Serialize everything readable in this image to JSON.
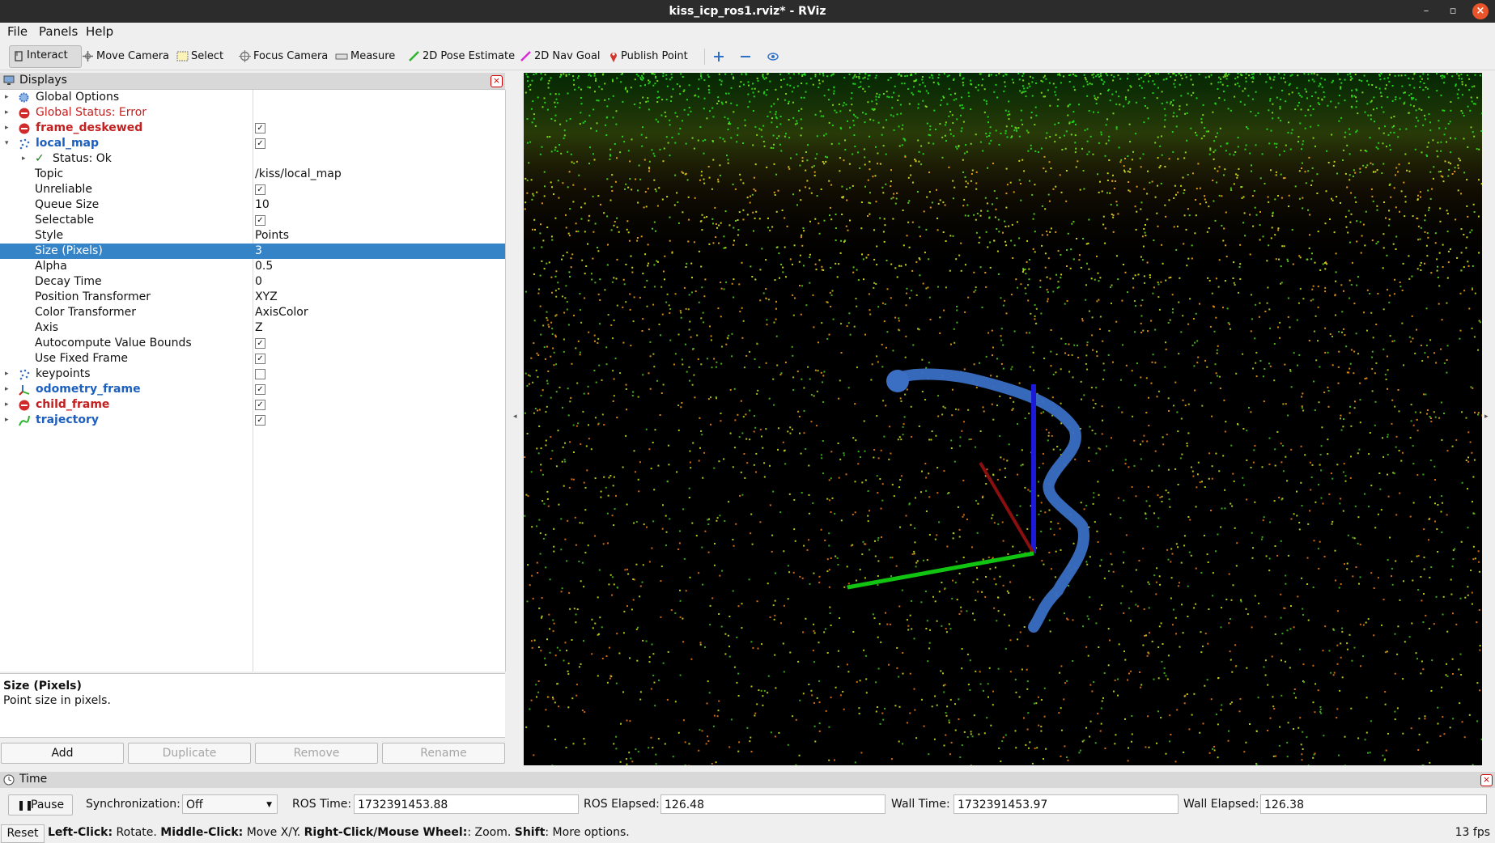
{
  "window": {
    "title": "kiss_icp_ros1.rviz* - RViz"
  },
  "menu": [
    "File",
    "Panels",
    "Help"
  ],
  "toolbar": {
    "interact": "Interact",
    "move_camera": "Move Camera",
    "select": "Select",
    "focus_camera": "Focus Camera",
    "measure": "Measure",
    "pose_estimate": "2D Pose Estimate",
    "nav_goal": "2D Nav Goal",
    "publish_point": "Publish Point"
  },
  "displays": {
    "header": "Displays",
    "rows": {
      "global_options": "Global Options",
      "global_status": "Global Status: Error",
      "frame_deskewed": "frame_deskewed",
      "local_map": "local_map",
      "status_ok": "Status: Ok",
      "topic": {
        "label": "Topic",
        "value": "/kiss/local_map"
      },
      "unreliable": "Unreliable",
      "queue_size": {
        "label": "Queue Size",
        "value": "10"
      },
      "selectable": "Selectable",
      "style": {
        "label": "Style",
        "value": "Points"
      },
      "size_pixels": {
        "label": "Size (Pixels)",
        "value": "3"
      },
      "alpha": {
        "label": "Alpha",
        "value": "0.5"
      },
      "decay_time": {
        "label": "Decay Time",
        "value": "0"
      },
      "position_transformer": {
        "label": "Position Transformer",
        "value": "XYZ"
      },
      "color_transformer": {
        "label": "Color Transformer",
        "value": "AxisColor"
      },
      "axis": {
        "label": "Axis",
        "value": "Z"
      },
      "autocompute": "Autocompute Value Bounds",
      "use_fixed_frame": "Use Fixed Frame",
      "keypoints": "keypoints",
      "odometry_frame": "odometry_frame",
      "child_frame": "child_frame",
      "trajectory": "trajectory"
    },
    "description": {
      "title": "Size (Pixels)",
      "text": "Point size in pixels."
    },
    "buttons": {
      "add": "Add",
      "duplicate": "Duplicate",
      "remove": "Remove",
      "rename": "Rename"
    }
  },
  "time": {
    "header": "Time",
    "pause": "Pause",
    "sync_label": "Synchronization:",
    "sync_value": "Off",
    "ros_time_label": "ROS Time:",
    "ros_time": "1732391453.88",
    "ros_elapsed_label": "ROS Elapsed:",
    "ros_elapsed": "126.48",
    "wall_time_label": "Wall Time:",
    "wall_time": "1732391453.97",
    "wall_elapsed_label": "Wall Elapsed:",
    "wall_elapsed": "126.38"
  },
  "status": {
    "reset": "Reset",
    "left_click": "Left-Click:",
    "left_click_desc": " Rotate. ",
    "middle_click": "Middle-Click:",
    "middle_click_desc": " Move X/Y. ",
    "right_click": "Right-Click/Mouse Wheel:",
    "right_click_desc": ": Zoom. ",
    "shift": "Shift",
    "shift_desc": ": More options.",
    "fps": "13 fps"
  },
  "colors": {
    "selection": "#3584c8",
    "error": "#c42020",
    "link": "#1d5fbf",
    "trajectory": "#3a6fc4"
  }
}
